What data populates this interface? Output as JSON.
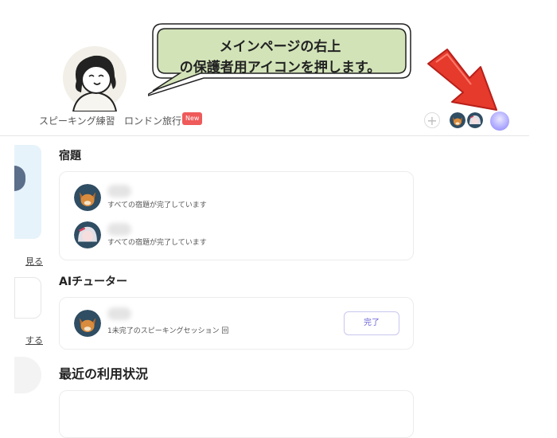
{
  "callout": {
    "line1": "メインページの右上",
    "line2": "の保護者用アイコンを押します。"
  },
  "nav": {
    "links": [
      "スピーキング練習",
      "ロンドン旅行"
    ],
    "new_badge": "New",
    "add_icon": "+"
  },
  "left_column": {
    "link1": "見る",
    "link2": "する"
  },
  "homework": {
    "title": "宿題",
    "rows": [
      {
        "status": "すべての宿題が完了しています"
      },
      {
        "status": "すべての宿題が完了しています"
      }
    ]
  },
  "ai_tutor": {
    "title": "AIチューター",
    "status": "1未完了のスピーキングセッション 回",
    "button": "完了"
  },
  "usage": {
    "title": "最近の利用状況"
  },
  "colors": {
    "accent": "#6a63d6",
    "callout_fill": "#d2e3b8",
    "arrow": "#e53a2c",
    "badge": "#ef5a5a"
  }
}
